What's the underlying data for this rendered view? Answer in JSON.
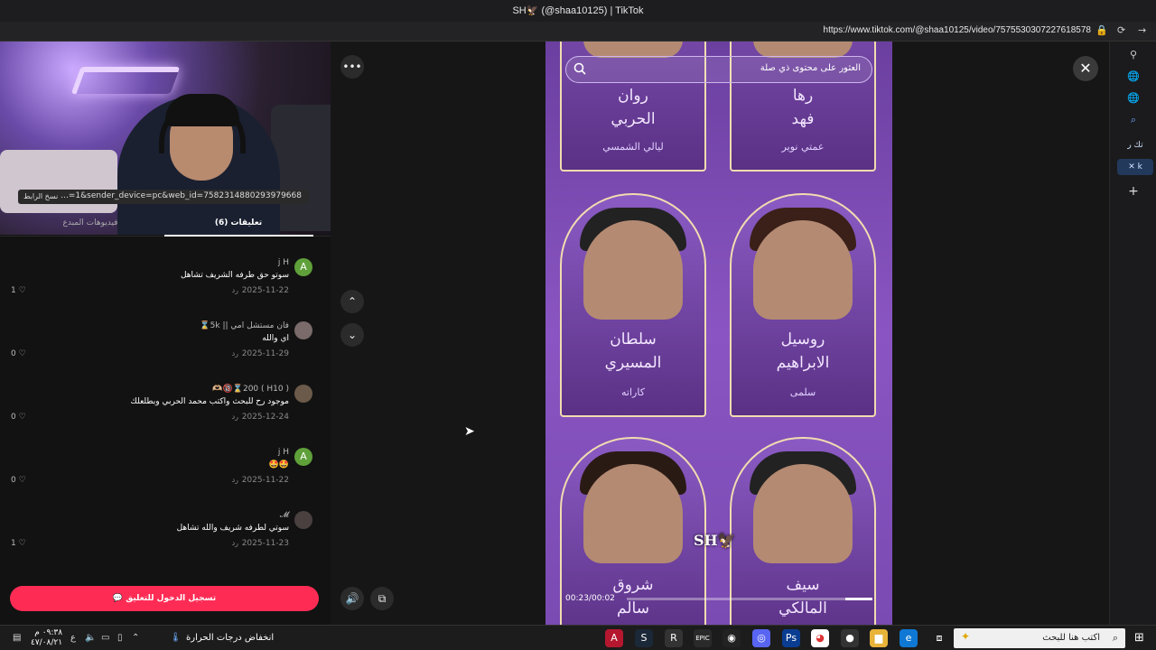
{
  "window": {
    "title": "SH🦅 (@shaa10125) | TikTok",
    "url": "https://www.tiktok.com/@shaa10125/video/7575530307227618578"
  },
  "left_panel": {
    "copy_link_label": "نسخ الرابط",
    "link_text": "...=1&sender_device=pc&web_id=7582314880293979668",
    "tabs": [
      {
        "label": "(6) تعليقات",
        "active": true
      },
      {
        "label": "فيديوهات المبدع",
        "active": false
      }
    ],
    "comments": [
      {
        "avatar_letter": "A",
        "avatar_color": "#5fa03a",
        "user": "j H",
        "text": "سوتو حق طرفه الشريف تشاهل",
        "date": "2025-11-22",
        "reply": "رد",
        "likes": "1"
      },
      {
        "avatar_letter": "",
        "avatar_color": "#7a6a6a",
        "user": "فان مستشل امي || 5k⌛",
        "text": "اي والله",
        "date": "2025-11-29",
        "reply": "رد",
        "likes": "0"
      },
      {
        "avatar_letter": "",
        "avatar_color": "#6b5a4a",
        "user": "( H10 ) 200⌛🔞🫶🏼",
        "text": "موجود رح للبحث واكتب محمد الحربي وبطلعلك",
        "date": "2025-12-24",
        "reply": "رد",
        "likes": "0"
      },
      {
        "avatar_letter": "A",
        "avatar_color": "#5fa03a",
        "user": "j H",
        "text": "🤩🤩",
        "date": "2025-11-22",
        "reply": "رد",
        "likes": "0"
      },
      {
        "avatar_letter": "",
        "avatar_color": "#4a4040",
        "user": "𝓜",
        "text": "سوتي لطرفه شريف والله تشاهل",
        "date": "2025-11-23",
        "reply": "رد",
        "likes": "1"
      }
    ],
    "login_button": "تسجيل الدخول للتعليق"
  },
  "video": {
    "search_placeholder": "العثور على محتوى ذي صلة",
    "cards": [
      {
        "name_line1": "رها",
        "name_line2": "فهد",
        "role": "عمتي نوير"
      },
      {
        "name_line1": "روان",
        "name_line2": "الحربي",
        "role": "ليالي الشمسي"
      },
      {
        "name_line1": "روسيل",
        "name_line2": "الابراهيم",
        "role": "سلمى"
      },
      {
        "name_line1": "سلطان",
        "name_line2": "المسيري",
        "role": "كاراته"
      },
      {
        "name_line1": "سيف",
        "name_line2": "المالكي",
        "role": ""
      },
      {
        "name_line1": "شروق",
        "name_line2": "سالم",
        "role": ""
      }
    ],
    "watermark": "SH🦅",
    "timecode": "00:23/00:02",
    "progress_fraction": 0.11
  },
  "sidepanel": {
    "pill_1": "تك ر",
    "pill_2": "✕ k"
  },
  "taskbar": {
    "search_placeholder": "اكتب هنا للبحث",
    "weather": "انخفاض درجات الحرارة",
    "clock_time": "٠٩:٣٨ م",
    "clock_date": "٤٧/٠٨/٢١",
    "lang": "ع"
  }
}
